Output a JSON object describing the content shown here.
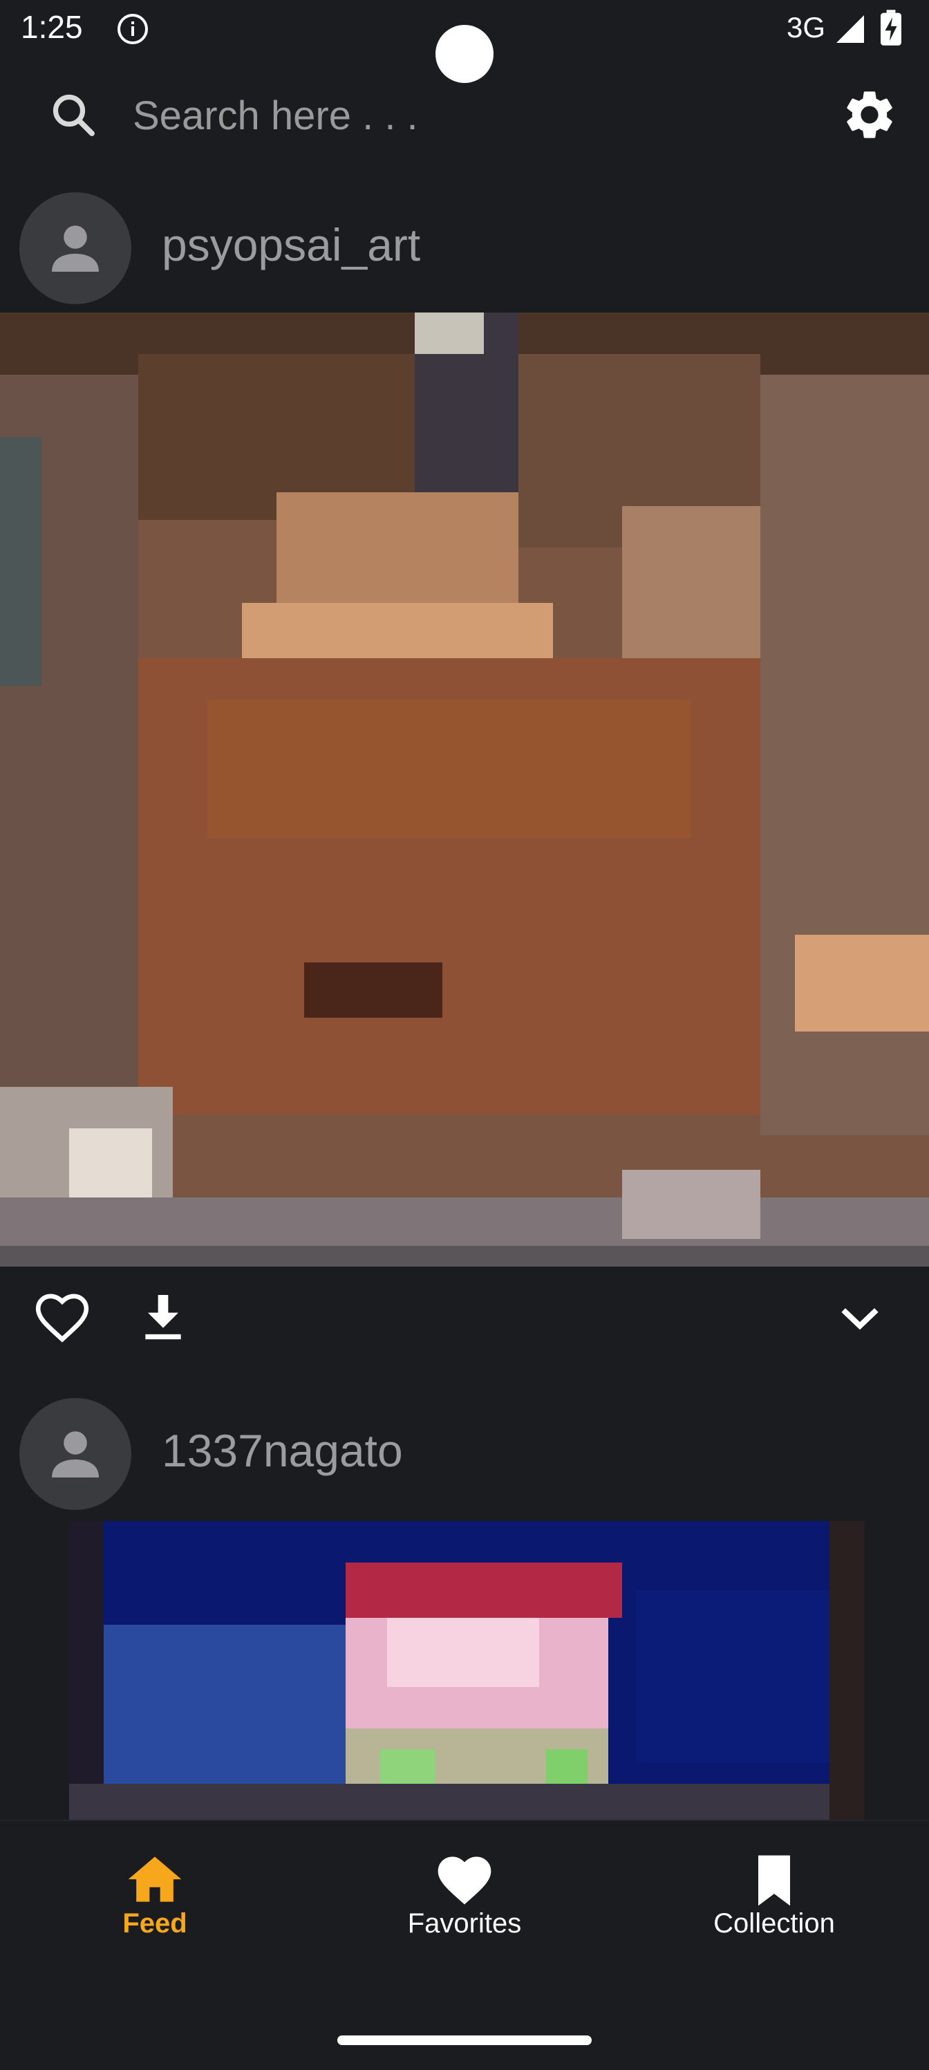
{
  "status_bar": {
    "time": "1:25",
    "network": "3G",
    "icons": [
      "info-icon",
      "signal-icon",
      "battery-charging-icon"
    ]
  },
  "search": {
    "placeholder": "Search here . . .",
    "value": "",
    "icons": [
      "search-icon",
      "gear-icon"
    ]
  },
  "feed": {
    "posts": [
      {
        "username": "psyopsai_art",
        "image": "pixelated-artwork",
        "actions": [
          "heart-outline-icon",
          "download-icon",
          "chevron-down-icon"
        ]
      },
      {
        "username": "1337nagato",
        "image": "pixelated-artwork"
      }
    ]
  },
  "bottom_nav": {
    "items": [
      {
        "label": "Feed",
        "icon": "home-icon",
        "active": true
      },
      {
        "label": "Favorites",
        "icon": "heart-icon",
        "active": false
      },
      {
        "label": "Collection",
        "icon": "bookmark-icon",
        "active": false
      }
    ]
  },
  "colors": {
    "background": "#1b1c1f",
    "accent": "#f7a71c",
    "avatar_bg": "#3a3b3f",
    "username_text": "#9c9ca0"
  }
}
